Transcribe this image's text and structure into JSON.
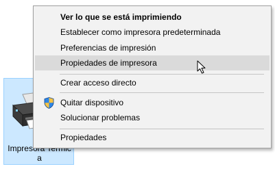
{
  "desktop_icon": {
    "label": "Impresora Termica",
    "icon": "printer-icon",
    "selected": true
  },
  "context_menu": {
    "items": [
      {
        "label": "Ver lo que se está imprimiendo",
        "bold": true
      },
      {
        "label": "Establecer como impresora predeterminada"
      },
      {
        "label": "Preferencias de impresión"
      },
      {
        "label": "Propiedades de impresora",
        "highlighted": true
      },
      {
        "label": "Crear acceso directo"
      },
      {
        "label": "Quitar dispositivo",
        "icon": "uac-shield-icon"
      },
      {
        "label": "Solucionar problemas"
      },
      {
        "label": "Propiedades"
      }
    ]
  },
  "colors": {
    "menu_background": "#f2f2f2",
    "menu_hover": "#dadada",
    "selection_fill": "#cce8ff",
    "selection_border": "#99d1ff"
  },
  "cursor": "arrow-cursor-icon"
}
